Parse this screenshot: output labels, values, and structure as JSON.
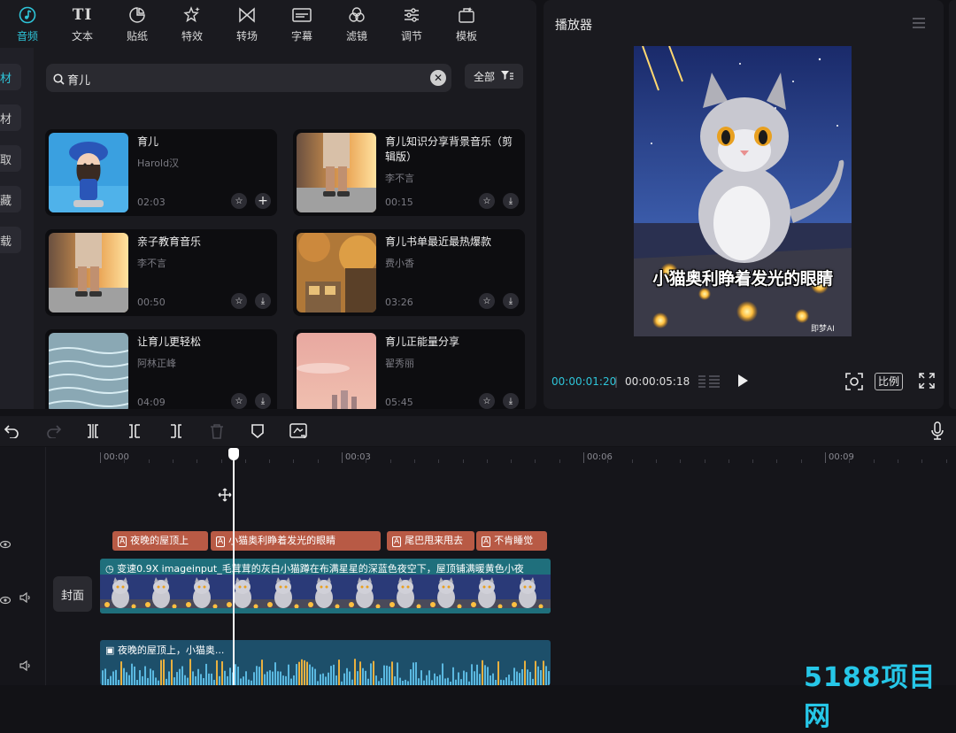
{
  "tabs": [
    {
      "label": "音频",
      "icon": "music-note-icon",
      "active": true
    },
    {
      "label": "文本",
      "icon": "text-ti-icon"
    },
    {
      "label": "贴纸",
      "icon": "sticker-icon"
    },
    {
      "label": "特效",
      "icon": "sparkle-star-icon"
    },
    {
      "label": "转场",
      "icon": "transition-bowtie-icon"
    },
    {
      "label": "字幕",
      "icon": "caption-icon"
    },
    {
      "label": "滤镜",
      "icon": "filter-circles-icon"
    },
    {
      "label": "调节",
      "icon": "adjust-sliders-icon"
    },
    {
      "label": "模板",
      "icon": "template-icon"
    }
  ],
  "sidenav": [
    {
      "label": "材",
      "active": true
    },
    {
      "label": "材"
    },
    {
      "label": "取"
    },
    {
      "label": "藏"
    },
    {
      "label": "载"
    }
  ],
  "search": {
    "value": "育儿",
    "filter_label": "全部"
  },
  "results": [
    {
      "title": "育儿",
      "artist": "Harold汉",
      "duration": "02:03",
      "action": "add",
      "thumb": "doll"
    },
    {
      "title": "育儿知识分享背景音乐（剪辑版）",
      "artist": "李不言",
      "duration": "00:15",
      "action": "download",
      "thumb": "child"
    },
    {
      "title": "亲子教育音乐",
      "artist": "李不言",
      "duration": "00:50",
      "action": "download",
      "thumb": "child"
    },
    {
      "title": "育儿书单最近最热爆款",
      "artist": "费小香",
      "duration": "03:26",
      "action": "download",
      "thumb": "autumn"
    },
    {
      "title": "让育儿更轻松",
      "artist": "阿林正峰",
      "duration": "04:09",
      "action": "download",
      "thumb": "water"
    },
    {
      "title": "育儿正能量分享",
      "artist": "翟秀丽",
      "duration": "05:45",
      "action": "download",
      "thumb": "sky"
    }
  ],
  "player": {
    "title": "播放器",
    "subtitle": "小猫奥利睁着发光的眼睛",
    "watermark": "即梦AI",
    "current_time": "00:00:01:20",
    "total_time": "00:00:05:18",
    "ratio_label": "比例"
  },
  "timeline": {
    "ticks": [
      "00:00",
      "00:03",
      "00:06",
      "00:09"
    ],
    "subtitles": [
      "夜晚的屋顶上",
      "小猫奥利睁着发光的眼睛",
      "尾巴甩来甩去",
      "不肯睡觉"
    ],
    "video_clip_label": "变速0.9X  imageinput_毛茸茸的灰白小猫蹲在布满星星的深蓝色夜空下，屋顶铺满暖黄色小夜",
    "audio_clip_label": "夜晚的屋顶上，小猫奥...",
    "cover_label": "封面"
  },
  "site_watermark": "5188项目网",
  "colors": {
    "accent": "#2ec4d8",
    "subtitle_clip": "#b85a45",
    "video_clip": "#1f6f7c",
    "audio_clip": "#1d4f6a"
  }
}
